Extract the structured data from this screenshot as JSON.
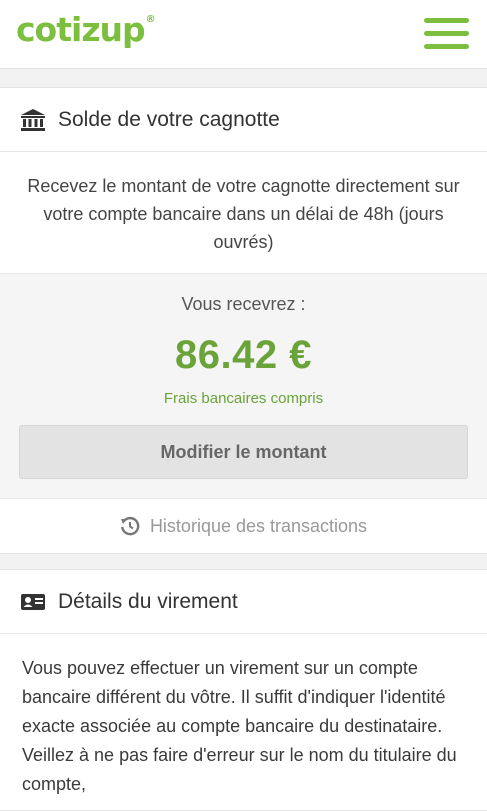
{
  "header": {
    "logo_text": "cotizup",
    "logo_mark": "®",
    "menu_icon": "hamburger-menu-icon",
    "brand_color": "#7cbf3f"
  },
  "balance": {
    "title": "Solde de votre cagnotte",
    "icon": "bank-icon",
    "intro": "Recevez le montant de votre cagnotte directement sur votre compte bancaire dans un délai de 48h (jours ouvrés)",
    "receive_label": "Vous recevrez :",
    "amount": "86.42 €",
    "fees_note": "Frais bancaires compris",
    "modify_button": "Modifier le montant",
    "history_link": "Historique des transactions",
    "history_icon": "history-icon",
    "amount_color": "#6aa33a"
  },
  "transfer": {
    "title": "Détails du virement",
    "icon": "id-card-icon",
    "text": "Vous pouvez effectuer un virement sur un compte bancaire différent du vôtre. Il suffit d'indiquer l'identité exacte associée au compte bancaire du destinataire. Veillez à ne pas faire d'erreur sur le nom du titulaire du compte,"
  }
}
